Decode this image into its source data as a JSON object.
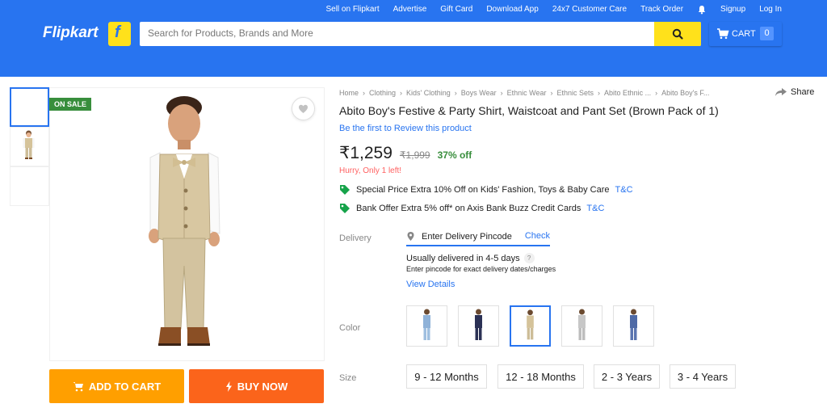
{
  "header": {
    "top_links": [
      "Sell on Flipkart",
      "Advertise",
      "Gift Card",
      "Download App",
      "24x7 Customer Care",
      "Track Order"
    ],
    "signup": "Signup",
    "login": "Log In",
    "logo": "Flipkart",
    "search_placeholder": "Search for Products, Brands and More",
    "cart_label": "CART",
    "cart_count": "0",
    "brand_color": "#2874f0",
    "accent_color": "#ffe11b"
  },
  "gallery": {
    "badge": "ON SALE",
    "thumbnail_count": 3,
    "active_thumbnail": 1
  },
  "actions": {
    "add_to_cart": "ADD TO CART",
    "buy_now": "BUY NOW"
  },
  "breadcrumbs": [
    "Home",
    "Clothing",
    "Kids' Clothing",
    "Boys Wear",
    "Ethnic Wear",
    "Ethnic Sets",
    "Abito Ethnic ...",
    "Abito Boy's F..."
  ],
  "share": "Share",
  "product": {
    "title": "Abito Boy's Festive & Party Shirt, Waistcoat and Pant Set  (Brown Pack of 1)",
    "review_link": "Be the first to Review this product",
    "price": "₹1,259",
    "mrp": "₹1,999",
    "discount": "37% off",
    "stock_note": "Hurry, Only 1 left!"
  },
  "offers": [
    {
      "text": "Special Price Extra 10% Off on Kids' Fashion, Toys & Baby Care",
      "tc": "T&C"
    },
    {
      "text": "Bank Offer Extra 5% off* on Axis Bank Buzz Credit Cards",
      "tc": "T&C"
    }
  ],
  "delivery": {
    "label": "Delivery",
    "pincode_placeholder": "Enter Delivery Pincode",
    "check": "Check",
    "estimate": "Usually delivered in 4-5 days",
    "help": "?",
    "note": "Enter pincode for exact delivery dates/charges",
    "view_details": "View Details"
  },
  "color": {
    "label": "Color",
    "swatches": [
      "light-blue",
      "navy",
      "beige",
      "grey",
      "blue"
    ],
    "selected_index": 2
  },
  "size": {
    "label": "Size",
    "options": [
      "9 - 12 Months",
      "12 - 18 Months",
      "2 - 3 Years",
      "3 - 4 Years"
    ]
  }
}
